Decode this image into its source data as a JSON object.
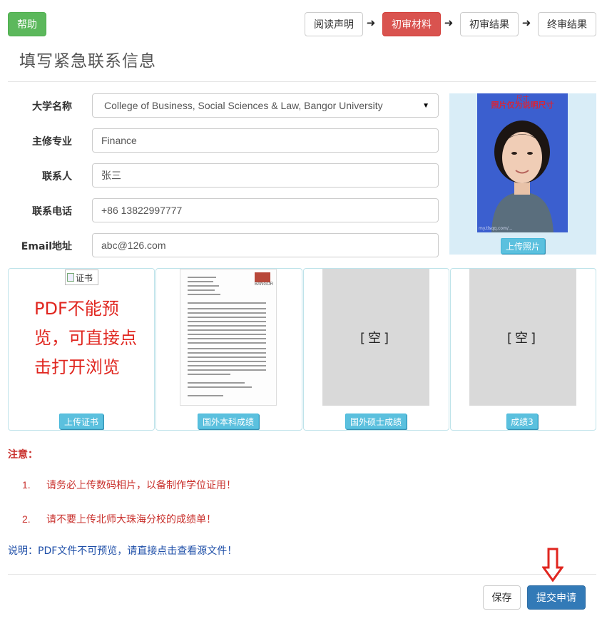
{
  "header": {
    "help_label": "帮助",
    "steps": [
      {
        "label": "阅读声明",
        "active": false
      },
      {
        "label": "初审材料",
        "active": true
      },
      {
        "label": "初审结果",
        "active": false
      },
      {
        "label": "终审结果",
        "active": false
      }
    ],
    "arrow_glyph": "➜"
  },
  "page_title": "填写紧急联系信息",
  "form": {
    "university": {
      "label": "大学名称",
      "value": "College of Business, Social Sciences & Law, Bangor University"
    },
    "major": {
      "label": "主修专业",
      "value": "Finance"
    },
    "contact": {
      "label": "联系人",
      "value": "张三"
    },
    "phone": {
      "label": "联系电话",
      "value": "+86 13822997777"
    },
    "email": {
      "label": "Email地址",
      "value": "abc@126.com"
    }
  },
  "photo": {
    "size_note": "尺寸",
    "note": "照片仅为说明尺寸",
    "watermark": "my.tlsqq.com/...",
    "upload_label": "上传照片"
  },
  "documents": [
    {
      "upload_label": "上传证书",
      "alt_text": "证书",
      "pdf_message": "PDF不能预览，可直接点击打开浏览"
    },
    {
      "upload_label": "国外本科成绩",
      "preview_text": "BANGOR"
    },
    {
      "upload_label": "国外硕士成绩",
      "empty_text": "[空]"
    },
    {
      "upload_label": "成绩3",
      "empty_text": "[空]"
    }
  ],
  "notice": {
    "title": "注意：",
    "items": [
      {
        "num": "1.",
        "text": "请务必上传数码相片，以备制作学位证用！"
      },
      {
        "num": "2.",
        "text": "请不要上传北师大珠海分校的成绩单！"
      }
    ],
    "explain": "说明：PDF文件不可预览，请直接点击查看源文件！"
  },
  "actions": {
    "save_label": "保存",
    "submit_label": "提交申请"
  },
  "colors": {
    "help": "#5cb85c",
    "active_step": "#d9534f",
    "upload": "#5bc0de",
    "submit": "#337ab7",
    "notice": "#c9302c",
    "pdf_message": "#e0261f"
  }
}
